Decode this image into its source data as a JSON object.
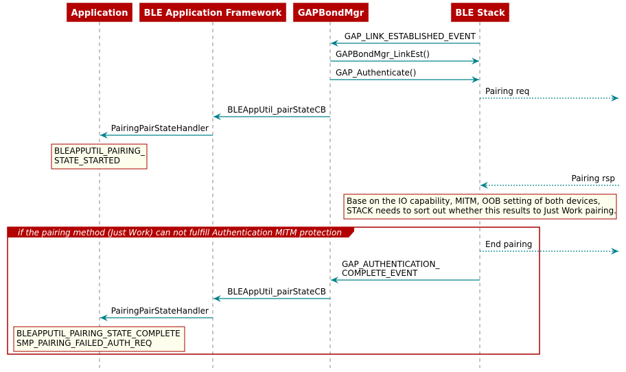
{
  "colors": {
    "participant_fill": "#b30000",
    "participant_text": "#ffffff",
    "arrow": "#00838a",
    "lifeline": "#888888",
    "note_fill": "#fefeec",
    "note_border": "#a80000",
    "frame_border": "#a80000",
    "frame_label_fill": "#b30000"
  },
  "participants": [
    {
      "id": "app",
      "label": "Application"
    },
    {
      "id": "fw",
      "label": "BLE Application Framework"
    },
    {
      "id": "gbm",
      "label": "GAPBondMgr"
    },
    {
      "id": "stack",
      "label": "BLE Stack"
    }
  ],
  "messages": [
    {
      "from": "stack",
      "to": "gbm",
      "label": [
        "GAP_LINK_ESTABLISHED_EVENT"
      ],
      "style": "solid"
    },
    {
      "from": "gbm",
      "to": "stack",
      "label": [
        "GAPBondMgr_LinkEst()"
      ],
      "style": "solid"
    },
    {
      "from": "gbm",
      "to": "stack",
      "label": [
        "GAP_Authenticate()"
      ],
      "style": "solid"
    },
    {
      "from": "stack",
      "to": "external",
      "label": [
        "Pairing req"
      ],
      "style": "dotted"
    },
    {
      "from": "gbm",
      "to": "fw",
      "label": [
        "BLEAppUtil_pairStateCB"
      ],
      "style": "solid"
    },
    {
      "from": "fw",
      "to": "app",
      "label": [
        "PairingPairStateHandler"
      ],
      "style": "solid"
    },
    {
      "from": "external",
      "to": "stack",
      "label": [
        "Pairing rsp"
      ],
      "style": "dotted"
    },
    {
      "from": "stack",
      "to": "external",
      "label": [
        "End pairing"
      ],
      "style": "dotted"
    },
    {
      "from": "stack",
      "to": "gbm",
      "label": [
        "GAP_AUTHENTICATION_",
        "COMPLETE_EVENT"
      ],
      "style": "solid"
    },
    {
      "from": "gbm",
      "to": "fw",
      "label": [
        "BLEAppUtil_pairStateCB"
      ],
      "style": "solid"
    },
    {
      "from": "fw",
      "to": "app",
      "label": [
        "PairingPairStateHandler"
      ],
      "style": "solid"
    }
  ],
  "notes": [
    {
      "over": "app",
      "lines": [
        "BLEAPPUTIL_PAIRING_",
        "STATE_STARTED"
      ]
    },
    {
      "over": "stack",
      "lines": [
        "Base on the IO capability, MITM, OOB setting of both devices,",
        "STACK needs to sort out whether this results to Just Work pairing."
      ]
    },
    {
      "over": "app",
      "lines": [
        "BLEAPPUTIL_PAIRING_STATE_COMPLETE",
        "SMP_PAIRING_FAILED_AUTH_REQ"
      ]
    }
  ],
  "frame": {
    "label": "if the pairing method (Just Work) can not fulfill Authentication MITM protection"
  }
}
